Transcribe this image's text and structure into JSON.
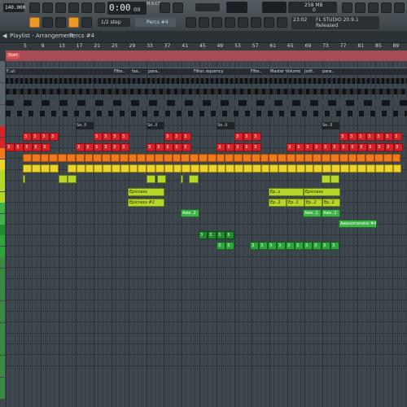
{
  "toolbar": {
    "tempo": "140.000",
    "time": "0:00",
    "time_sub": "00",
    "time_unit": "M:S:CS",
    "snap": "1/2 step",
    "pattern": "Percs #4",
    "memory": "258 MB",
    "cpu": "0",
    "version": "FL STUDIO 20.9.1",
    "version_sub": "Released",
    "news_num": "23:02"
  },
  "playlist": {
    "title": "Playlist - Arrangement",
    "pattern": "Percs #4",
    "ruler": [
      "5",
      "9",
      "13",
      "17",
      "21",
      "25",
      "29",
      "33",
      "37",
      "41",
      "45",
      "49",
      "53",
      "57",
      "61",
      "65",
      "69",
      "73",
      "77",
      "81",
      "85",
      "89"
    ],
    "start_marker": "Start"
  },
  "auto_labels": {
    "a1": "F..ut",
    "a2": "Filte..",
    "a3": "fas..",
    "a4": "para..",
    "a5": "Filter..equency",
    "a6": "Filte..",
    "a7": "Master Volume",
    "a8": "Jodf..",
    "a9": "para.."
  },
  "clip_labels": {
    "so": "So..ll",
    "epic1": "Epicness",
    "epic2": "Epicness #2",
    "ep": "Ep..s",
    "ep2": "Ep..2",
    "awe": "Awe..2",
    "awe4": "Awesomeness #4",
    "num": "3"
  },
  "colors": {
    "red": "#d8232a",
    "orange": "#f07a1b",
    "yellow": "#ecd22a",
    "lime": "#b7d62a",
    "green": "#3fb34a",
    "ruler": "#a74b57"
  }
}
